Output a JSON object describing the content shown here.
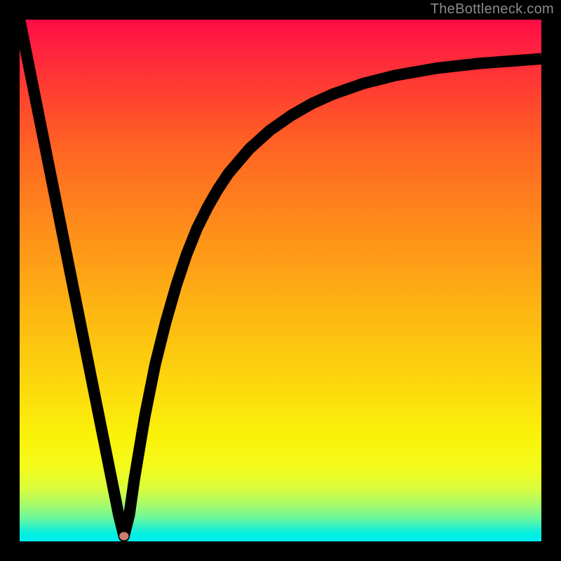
{
  "watermark": "TheBottleneck.com",
  "chart_data": {
    "type": "line",
    "title": "",
    "xlabel": "",
    "ylabel": "",
    "xlim": [
      0,
      100
    ],
    "ylim": [
      0,
      100
    ],
    "x": [
      0,
      2,
      4,
      6,
      8,
      10,
      12,
      14,
      16,
      18,
      19,
      20,
      21,
      22,
      24,
      26,
      28,
      30,
      32,
      34,
      36,
      38,
      40,
      44,
      48,
      52,
      56,
      60,
      66,
      72,
      80,
      88,
      96,
      100
    ],
    "y": [
      100,
      90,
      80,
      70,
      60,
      50,
      40,
      30,
      20,
      10,
      5,
      1,
      5,
      12,
      24,
      34,
      42,
      49,
      55,
      60,
      64,
      67.5,
      70.5,
      75.2,
      78.8,
      81.6,
      83.9,
      85.7,
      87.8,
      89.3,
      90.7,
      91.6,
      92.2,
      92.5
    ],
    "minimum_marker": {
      "x": 20,
      "y": 1
    },
    "background_gradient_stops": [
      {
        "pos": 0.0,
        "color": "#ff0b46"
      },
      {
        "pos": 0.05,
        "color": "#ff2040"
      },
      {
        "pos": 0.14,
        "color": "#ff4030"
      },
      {
        "pos": 0.25,
        "color": "#ff6522"
      },
      {
        "pos": 0.4,
        "color": "#fe8d1a"
      },
      {
        "pos": 0.55,
        "color": "#fdb412"
      },
      {
        "pos": 0.7,
        "color": "#fcd80d"
      },
      {
        "pos": 0.8,
        "color": "#fbf20a"
      },
      {
        "pos": 0.86,
        "color": "#f3fb1c"
      },
      {
        "pos": 0.9,
        "color": "#d8fc3e"
      },
      {
        "pos": 0.93,
        "color": "#a6fa6b"
      },
      {
        "pos": 0.955,
        "color": "#6cf79b"
      },
      {
        "pos": 0.975,
        "color": "#26f0cc"
      },
      {
        "pos": 0.985,
        "color": "#00f0df"
      },
      {
        "pos": 1.0,
        "color": "#00eef0"
      }
    ]
  }
}
